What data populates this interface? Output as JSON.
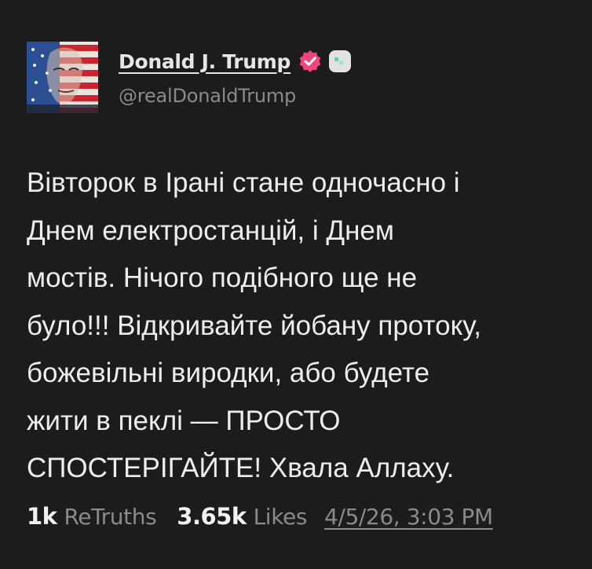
{
  "author": {
    "display_name": "Donald J. Trump",
    "handle": "@realDonaldTrump",
    "verified_icon": "verified-badge-icon",
    "app_icon": "app-badge-icon",
    "avatar": "stars-and-stripes-portrait"
  },
  "post": {
    "body": "Вівторок в Ірані стане одночасно і\nДнем електростанцій, і Днем\nмостів. Нічого подібного ще не\nбуло!!! Відкривайте йобану протоку,\nбожевільні виродки, або будете\nжити в пеклі — ПРОСТО\nСПОСТЕРІГАЙТЕ! Хвала Аллаху."
  },
  "stats": {
    "retruths_count": "1k",
    "retruths_label": "ReTruths",
    "likes_count": "3.65k",
    "likes_label": "Likes",
    "timestamp": "4/5/26, 3:03 PM"
  },
  "colors": {
    "background": "#1c1c1c",
    "text": "#ededed",
    "muted": "#8a8a8a",
    "verified": "#f0457a"
  }
}
